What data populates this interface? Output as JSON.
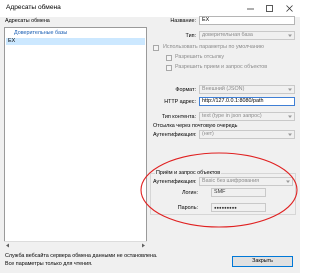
{
  "window": {
    "title": "Адресаты обмена"
  },
  "left": {
    "label": "Адресаты обмена",
    "list": [
      {
        "label": "Доверительные базы",
        "type": "header"
      },
      {
        "label": "EX",
        "type": "item"
      }
    ]
  },
  "right": {
    "name": {
      "label": "Название:",
      "value": "EX"
    },
    "type": {
      "label": "Тип:",
      "value": "доверительная база"
    },
    "use_default": {
      "label": "Использовать параметры по умолчанию"
    },
    "allow_send": {
      "label": "Разрешить отсылку"
    },
    "allow_recv": {
      "label": "Разрешить прием и запрос объектов"
    },
    "format": {
      "label": "Формат:",
      "value": "Внешний (JSON)"
    },
    "http": {
      "label": "HTTP адрес:",
      "value": "http://127.0.0.1:8080/path"
    },
    "content_type": {
      "label": "Тип контента:",
      "value": "text (type in json запрос)"
    },
    "mail_queue": {
      "title": "Отсылка через почтовую очередь",
      "auth_label": "Аутентификация:",
      "auth_value": "(нет)"
    },
    "receive": {
      "title": "Приём и запрос объектов",
      "auth_label": "Аутентификация:",
      "auth_value": "Basic без шифрования",
      "login_label": "Логин:",
      "login_value": "SMF",
      "password_label": "Пароль:",
      "password_value": "●●●●●●●●●"
    }
  },
  "status": {
    "line1": "Служба вебсайта сервера обмена данными не остановлена.",
    "line2": "Все параметры только для чтения."
  },
  "buttons": {
    "close": "Закрыть"
  },
  "colors": {
    "annotation": "#e02020",
    "selection": "#cce8ff",
    "header_link": "#1a5fb4"
  }
}
